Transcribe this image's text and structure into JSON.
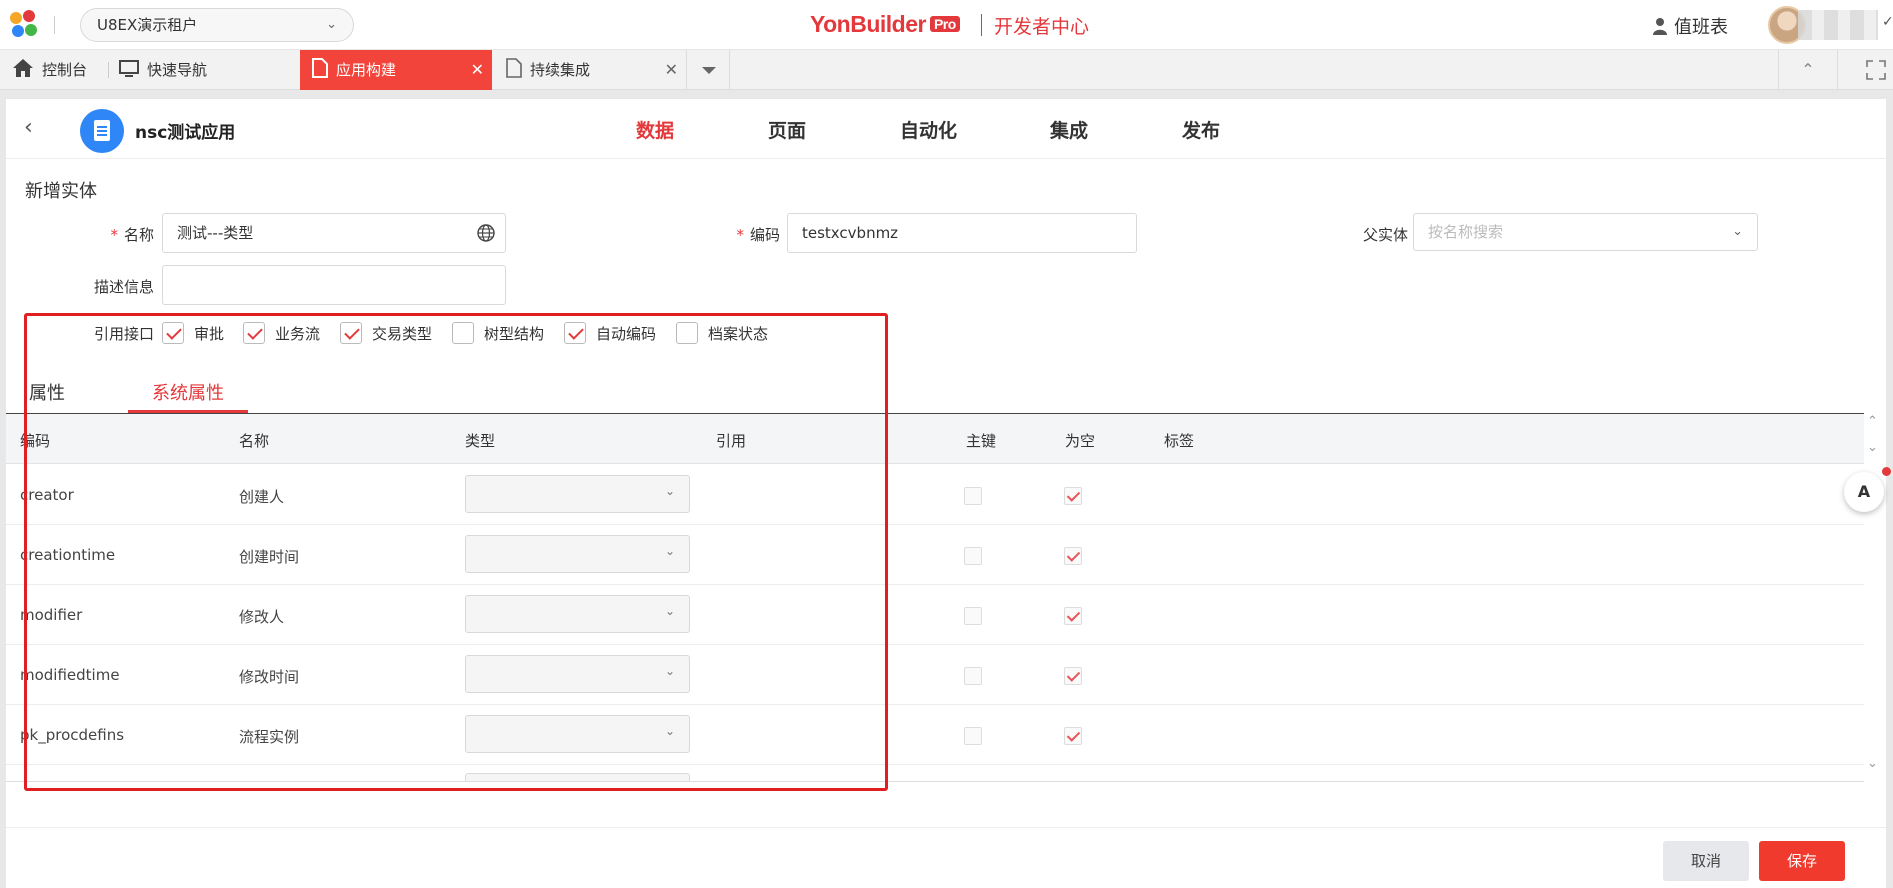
{
  "topbar": {
    "tenant": "U8EX演示租户",
    "brand": "YonBuilder",
    "brand_badge": "Pro",
    "dev_center": "开发者中心",
    "duty": "值班表"
  },
  "tabs": [
    {
      "label": "控制台",
      "icon": "home-icon"
    },
    {
      "label": "快速导航",
      "icon": "monitor-icon"
    },
    {
      "label": "应用构建",
      "icon": "document-icon",
      "active": true
    },
    {
      "label": "持续集成",
      "icon": "document-icon"
    }
  ],
  "app": {
    "name": "nsc测试应用",
    "nav": [
      "数据",
      "页面",
      "自动化",
      "集成",
      "发布"
    ],
    "active_nav": "数据"
  },
  "form": {
    "title": "新增实体",
    "name_label": "名称",
    "name_value": "测试---类型",
    "code_label": "编码",
    "code_value": "testxcvbnmz",
    "parent_label": "父实体",
    "parent_placeholder": "按名称搜索",
    "desc_label": "描述信息",
    "desc_value": "",
    "interfaces_label": "引用接口",
    "interfaces": [
      {
        "label": "审批",
        "checked": true
      },
      {
        "label": "业务流",
        "checked": true
      },
      {
        "label": "交易类型",
        "checked": true
      },
      {
        "label": "树型结构",
        "checked": false
      },
      {
        "label": "自动编码",
        "checked": true
      },
      {
        "label": "档案状态",
        "checked": false
      }
    ]
  },
  "subtabs": [
    "属性",
    "系统属性"
  ],
  "active_subtab": "系统属性",
  "table": {
    "headers": [
      "编码",
      "名称",
      "类型",
      "引用",
      "主键",
      "为空",
      "标签"
    ],
    "rows": [
      {
        "code": "creator",
        "name": "创建人",
        "pk": false,
        "nullable": true
      },
      {
        "code": "creationtime",
        "name": "创建时间",
        "pk": false,
        "nullable": true
      },
      {
        "code": "modifier",
        "name": "修改人",
        "pk": false,
        "nullable": true
      },
      {
        "code": "modifiedtime",
        "name": "修改时间",
        "pk": false,
        "nullable": true
      },
      {
        "code": "pk_procdefins",
        "name": "流程实例",
        "pk": false,
        "nullable": true
      }
    ]
  },
  "assistant_label": "A",
  "buttons": {
    "cancel": "取消",
    "save": "保存"
  }
}
